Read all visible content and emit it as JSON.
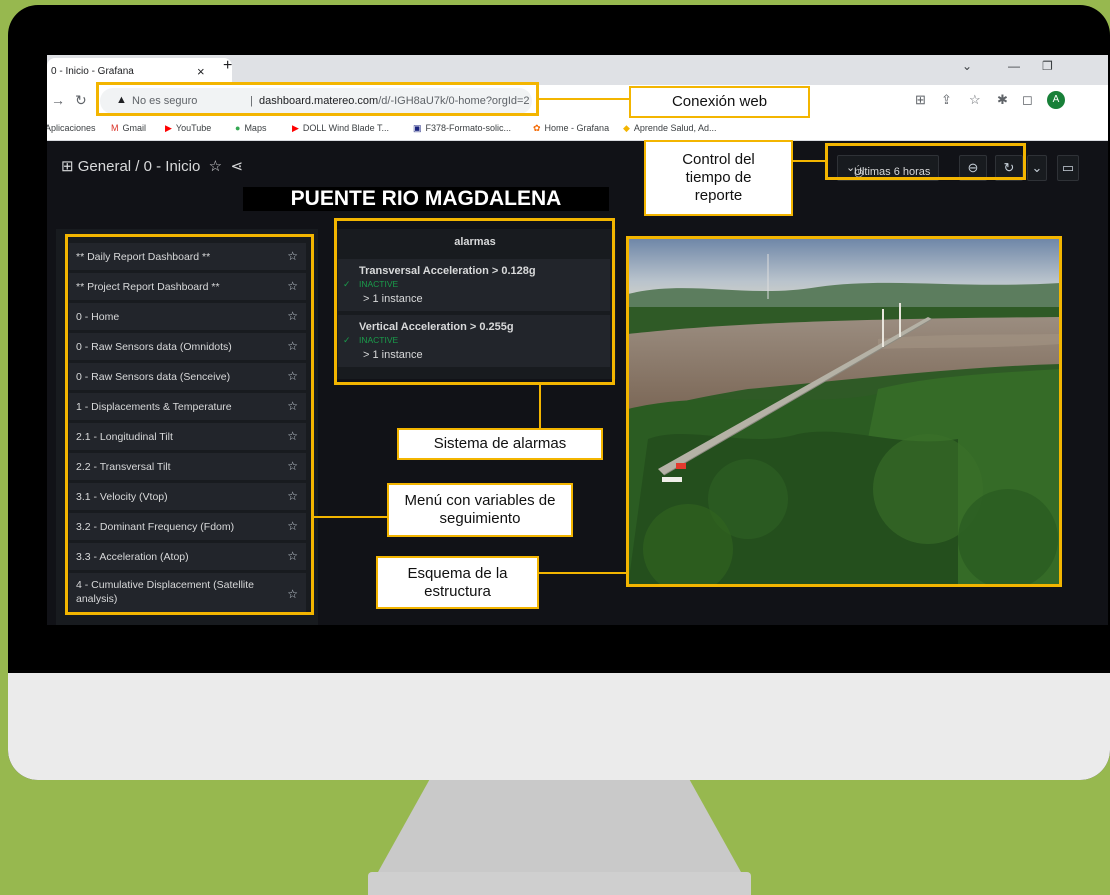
{
  "browser": {
    "tab_title": "0 - Inicio - Grafana",
    "tab_close": "×",
    "new_tab": "+",
    "security_label": "No es seguro",
    "url_host": "dashboard.matereo.com",
    "url_path": "/d/-IGH8aU7k/0-home?orgId=2",
    "avatar_letter": "A",
    "bookmarks": [
      "Aplicaciones",
      "Gmail",
      "YouTube",
      "Maps",
      "DOLL Wind Blade T...",
      "F378-Formato-solic...",
      "Home - Grafana",
      "Aprende Salud, Ad..."
    ]
  },
  "dashboard": {
    "breadcrumb": "General / 0 - Inicio",
    "time_range": "Últimas 6 horas",
    "title": "PUENTE RIO MAGDALENA",
    "menu_items": [
      "** Daily Report Dashboard **",
      "** Project Report Dashboard **",
      "0 - Home",
      "0 - Raw Sensors data (Omnidots)",
      "0 - Raw Sensors data (Senceive)",
      "1 - Displacements & Temperature",
      "2.1 - Longitudinal Tilt",
      "2.2 - Transversal Tilt",
      "3.1 - Velocity (Vtop)",
      "3.2 - Dominant Frequency (Fdom)",
      "3.3 - Acceleration (Atop)",
      "4 - Cumulative Displacement (Satellite analysis)"
    ],
    "alarms": {
      "title": "alarmas",
      "items": [
        {
          "name": "Transversal Acceleration > 0.128g",
          "state": "INACTIVE",
          "instances": "> 1 instance"
        },
        {
          "name": "Vertical Acceleration > 0.255g",
          "state": "INACTIVE",
          "instances": "> 1 instance"
        }
      ]
    }
  },
  "callouts": {
    "web": "Conexión web",
    "time_control": "Control del tiempo de reporte",
    "alarms": "Sistema de alarmas",
    "menu": "Menú con variables de seguimiento",
    "structure": "Esquema de la estructura"
  },
  "colors": {
    "background": "#97b84f",
    "highlight": "#f3b500",
    "grafana_bg": "#111217",
    "panel": "#181b1f"
  }
}
